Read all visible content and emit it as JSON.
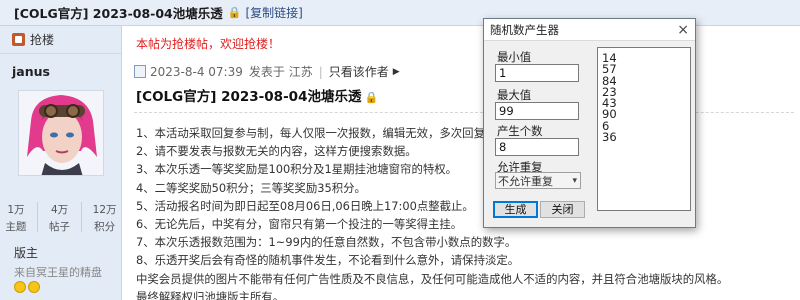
{
  "page": {
    "title": "[COLG官方] 2023-08-04池塘乐透",
    "copy_link": "[复制链接]"
  },
  "sidebar": {
    "floor_label": "抢楼",
    "username": "janus",
    "stats": [
      {
        "value": "1万",
        "label": "主题"
      },
      {
        "value": "4万",
        "label": "帖子"
      },
      {
        "value": "12万",
        "label": "积分"
      }
    ],
    "role": "版主",
    "tagline": "来自冥王星的精盘"
  },
  "post": {
    "notice": "本帖为抢楼帖，欢迎抢楼！",
    "datetime": "2023-8-4 07:39",
    "posted_from": "发表于 江苏",
    "only_author": "只看该作者",
    "title": "[COLG官方] 2023-08-04池塘乐透",
    "lines": [
      "1、本活动采取回复参与制，每人仅限一次报数，编辑无效，多次回复无效。",
      "2、请不要发表与报数无关的内容，这样方便搜索数据。",
      "3、本次乐透一等奖奖励是100积分及1星期挂池塘窗帘的特权。",
      "4、二等奖奖励50积分；三等奖奖励35积分。",
      "5、活动报名时间为即日起至08月06日,06日晚上17:00点整截止。",
      "6、无论先后，中奖有分，窗帘只有第一个投注的一等奖得主挂。",
      "7、本次乐透报数范围为：1~99内的任意自然数，不包含带小数点的数字。",
      "8、乐透开奖后会有奇怪的随机事件发生，不论看到什么意外，请保持淡定。",
      "中奖会员提供的图片不能带有任何广告性质及不良信息，及任何可能造成他人不适的内容，并且符合池塘版块的风格。",
      "最终解释权归池塘版主所有。"
    ]
  },
  "dialog": {
    "title": "随机数产生器",
    "close_icon": "×",
    "min_label": "最小值",
    "min_value": "1",
    "max_label": "最大值",
    "max_value": "99",
    "count_label": "产生个数",
    "count_value": "8",
    "repeat_label": "允许重复",
    "repeat_selected": "不允许重复",
    "generate_button": "生成",
    "close_button": "关闭",
    "results": [
      "14",
      "57",
      "84",
      "23",
      "43",
      "90",
      "6",
      "36"
    ]
  }
}
